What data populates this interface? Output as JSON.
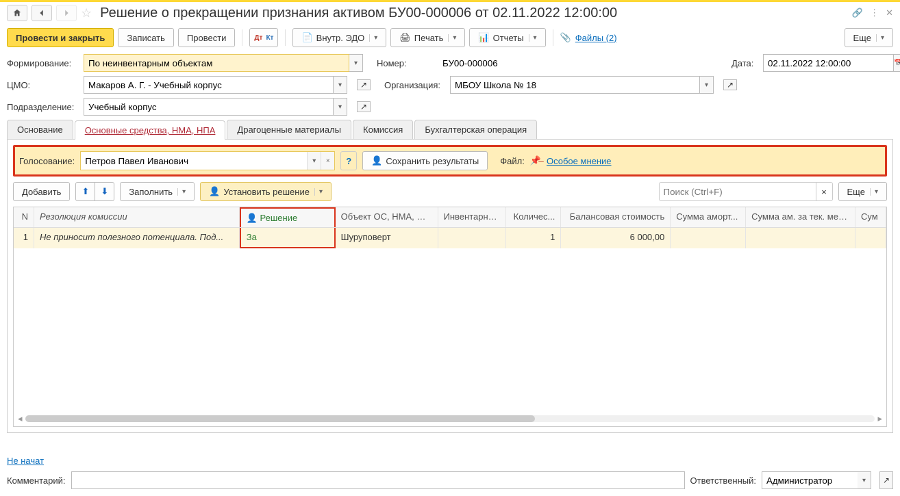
{
  "title": "Решение о прекращении признания активом БУ00-000006 от 02.11.2022 12:00:00",
  "toolbar": {
    "post_close": "Провести и закрыть",
    "save": "Записать",
    "post": "Провести",
    "edo": "Внутр. ЭДО",
    "print": "Печать",
    "reports": "Отчеты",
    "files": "Файлы (2)",
    "more": "Еще"
  },
  "fields": {
    "forming_label": "Формирование:",
    "forming_value": "По неинвентарным объектам",
    "number_label": "Номер:",
    "number_value": "БУ00-000006",
    "date_label": "Дата:",
    "date_value": "02.11.2022 12:00:00",
    "cmo_label": "ЦМО:",
    "cmo_value": "Макаров А. Г. - Учебный корпус",
    "org_label": "Организация:",
    "org_value": "МБОУ Школа № 18",
    "dept_label": "Подразделение:",
    "dept_value": "Учебный корпус"
  },
  "tabs": {
    "t0": "Основание",
    "t1": "Основные средства, НМА, НПА",
    "t2": "Драгоценные материалы",
    "t3": "Комиссия",
    "t4": "Бухгалтерская операция"
  },
  "voting": {
    "label": "Голосование:",
    "person": "Петров Павел Иванович",
    "save_result": "Сохранить результаты",
    "file_label": "Файл:",
    "opinion_link": "Особое мнение"
  },
  "grid_toolbar": {
    "add": "Добавить",
    "fill": "Заполнить",
    "set_decision": "Установить решение",
    "search_placeholder": "Поиск (Ctrl+F)",
    "more": "Еще"
  },
  "grid": {
    "headers": {
      "n": "N",
      "resolution": "Резолюция комиссии",
      "decision": "Решение",
      "object": "Объект ОС, НМА, НПА",
      "inventory": "Инвентарны...",
      "qty": "Количес...",
      "balance": "Балансовая стоимость",
      "amort": "Сумма аморт...",
      "amort_cur": "Сумма ам. за тек. мес...",
      "sum": "Сум"
    },
    "rows": [
      {
        "n": "1",
        "resolution": "Не приносит полезного потенциала. Под...",
        "decision": "За",
        "object": "Шуруповерт",
        "inventory": "",
        "qty": "1",
        "balance": "6 000,00",
        "amort": "",
        "amort_cur": "",
        "sum": ""
      }
    ]
  },
  "footer": {
    "not_started": "Не начат",
    "comment_label": "Комментарий:",
    "responsible_label": "Ответственный:",
    "responsible_value": "Администратор"
  }
}
